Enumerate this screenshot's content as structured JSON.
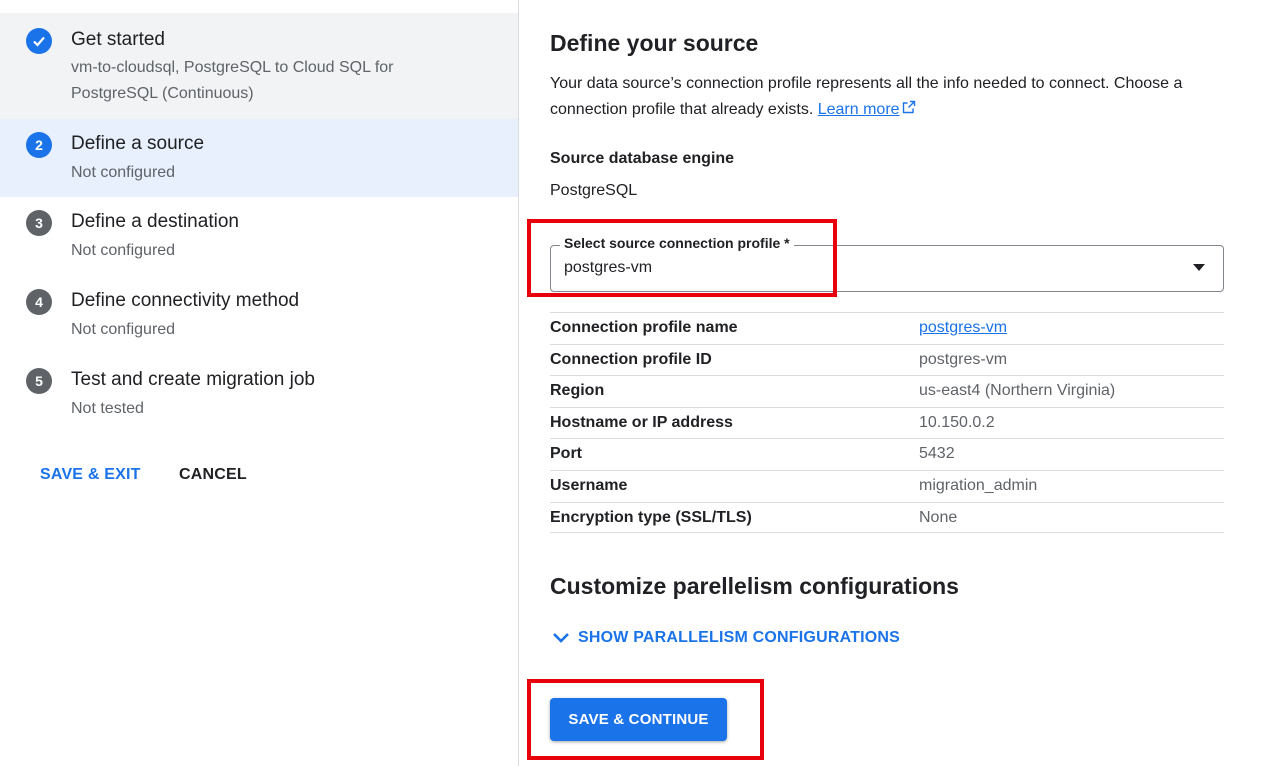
{
  "stepper": {
    "steps": [
      {
        "number": "",
        "title": "Get started",
        "subtitle": "vm-to-cloudsql, PostgreSQL to Cloud SQL for PostgreSQL (Continuous)",
        "state": "done"
      },
      {
        "number": "2",
        "title": "Define a source",
        "subtitle": "Not configured",
        "state": "active"
      },
      {
        "number": "3",
        "title": "Define a destination",
        "subtitle": "Not configured",
        "state": "pending"
      },
      {
        "number": "4",
        "title": "Define connectivity method",
        "subtitle": "Not configured",
        "state": "pending"
      },
      {
        "number": "5",
        "title": "Test and create migration job",
        "subtitle": "Not tested",
        "state": "pending"
      }
    ],
    "save_exit_label": "SAVE & EXIT",
    "cancel_label": "CANCEL"
  },
  "main": {
    "heading": "Define your source",
    "description": "Your data source’s connection profile represents all the info needed to connect. Choose a connection profile that already exists.",
    "learn_more": "Learn more",
    "engine_label": "Source database engine",
    "engine_value": "PostgreSQL",
    "select": {
      "label": "Select source connection profile *",
      "value": "postgres-vm"
    },
    "details": [
      {
        "key": "Connection profile name",
        "value": "postgres-vm"
      },
      {
        "key": "Connection profile ID",
        "value": "postgres-vm"
      },
      {
        "key": "Region",
        "value": "us-east4 (Northern Virginia)"
      },
      {
        "key": "Hostname or IP address",
        "value": "10.150.0.2"
      },
      {
        "key": "Port",
        "value": "5432"
      },
      {
        "key": "Username",
        "value": "migration_admin"
      },
      {
        "key": "Encryption type (SSL/TLS)",
        "value": "None"
      }
    ],
    "parallelism_heading": "Customize parellelism configurations",
    "show_parallelism": "SHOW PARALLELISM CONFIGURATIONS",
    "save_continue": "SAVE & CONTINUE"
  },
  "colors": {
    "accent": "#1a73e8",
    "highlight_box": "#e8000b",
    "active_step_bg": "#e8f0fe"
  }
}
